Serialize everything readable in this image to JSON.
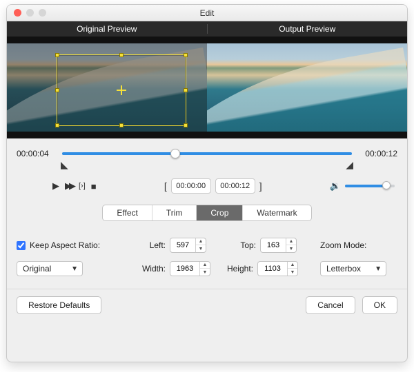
{
  "window": {
    "title": "Edit"
  },
  "preview": {
    "original_label": "Original Preview",
    "output_label": "Output Preview"
  },
  "timeline": {
    "start": "00:00:04",
    "end": "00:00:12",
    "position_pct": 39
  },
  "transport": {
    "in_time": "00:00:00",
    "out_time": "00:00:12",
    "volume_pct": 88
  },
  "tabs": {
    "items": [
      "Effect",
      "Trim",
      "Crop",
      "Watermark"
    ],
    "active_index": 2
  },
  "crop": {
    "keep_ar_label": "Keep Aspect Ratio:",
    "keep_ar_checked": true,
    "left_label": "Left:",
    "left": "597",
    "top_label": "Top:",
    "top": "163",
    "width_label": "Width:",
    "width": "1963",
    "height_label": "Height:",
    "height": "1103",
    "zoom_mode_label": "Zoom Mode:",
    "aspect_select": "Original",
    "zoom_select": "Letterbox"
  },
  "footer": {
    "restore": "Restore Defaults",
    "cancel": "Cancel",
    "ok": "OK"
  }
}
